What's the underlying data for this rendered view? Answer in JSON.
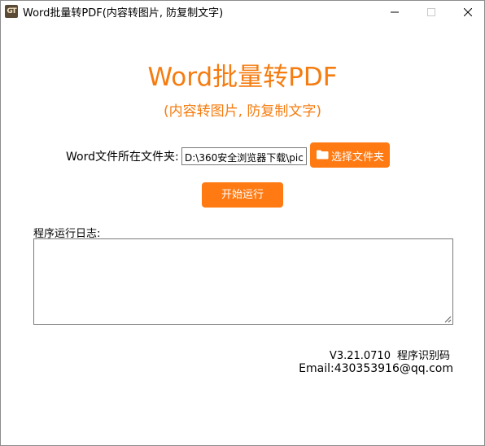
{
  "window": {
    "title": "Word批量转PDF(内容转图片, 防复制文字)",
    "icon_text": "GT"
  },
  "main": {
    "heading": "Word批量转PDF",
    "subheading": "(内容转图片, 防复制文字)",
    "folder_label": "Word文件所在文件夹:",
    "folder_path": "D:\\360安全浏览器下载\\pic",
    "select_folder_label": "选择文件夹",
    "start_label": "开始运行",
    "log_label": "程序运行日志:",
    "log_text": ""
  },
  "footer": {
    "version": "V3.21.0710",
    "machine_code_label": "程序识别码",
    "email": "Email:430353916@qq.com"
  },
  "colors": {
    "accent": "#ff7a12",
    "heading": "#f57c10"
  },
  "icons": [
    "app-icon",
    "minimize-icon",
    "maximize-icon",
    "close-icon",
    "folder-icon",
    "resize-grip-icon"
  ]
}
